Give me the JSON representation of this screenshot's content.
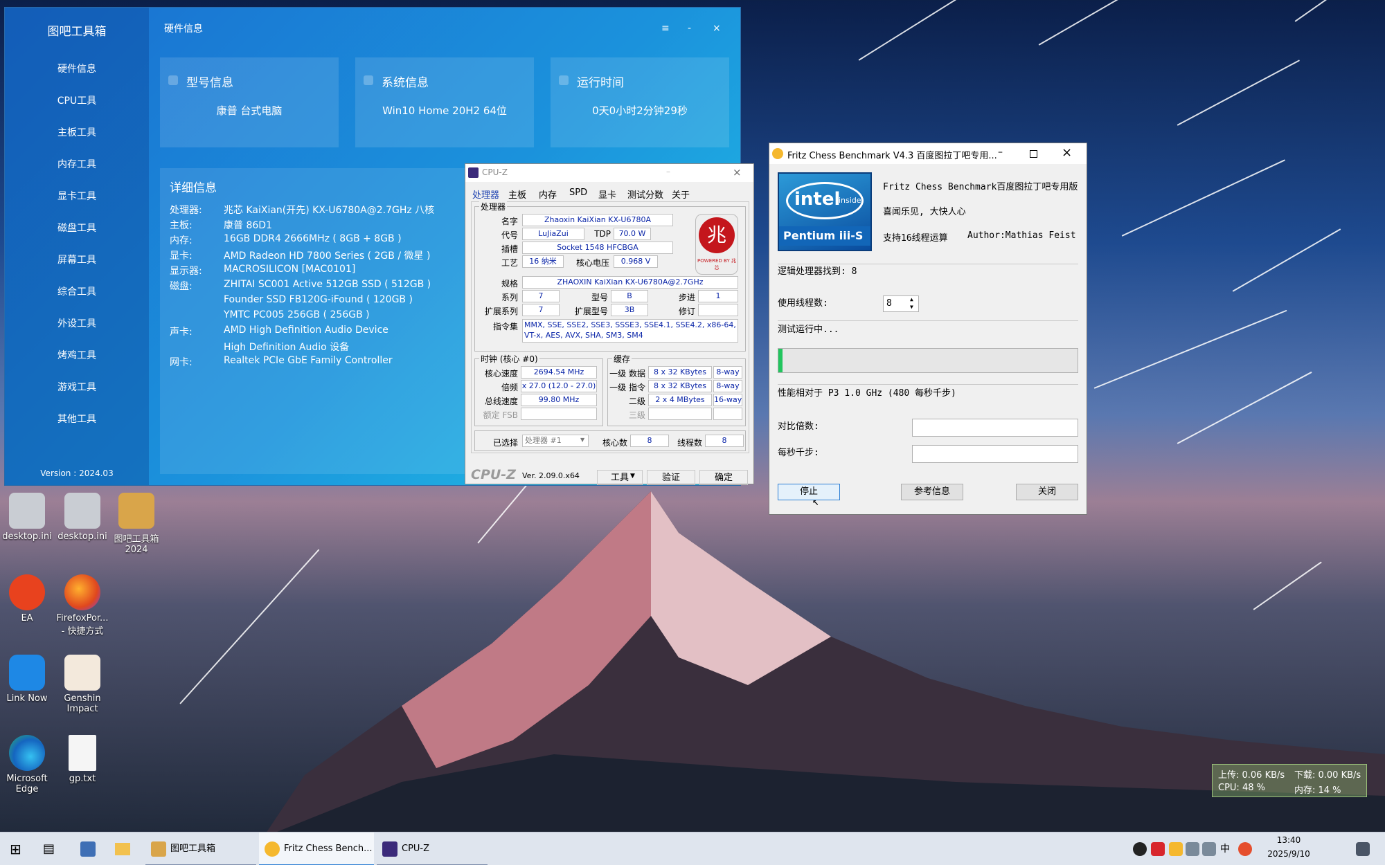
{
  "toolbox": {
    "title": "图吧工具箱",
    "nav": [
      "硬件信息",
      "CPU工具",
      "主板工具",
      "内存工具",
      "显卡工具",
      "磁盘工具",
      "屏幕工具",
      "综合工具",
      "外设工具",
      "烤鸡工具",
      "游戏工具",
      "其他工具"
    ],
    "version": "Version : 2024.03",
    "header": "硬件信息",
    "ctrl": {
      "menu": "≡",
      "min": "-",
      "close": "×"
    },
    "cards": [
      {
        "title": "型号信息",
        "value": "康普  台式电脑"
      },
      {
        "title": "系统信息",
        "value": "Win10 Home 20H2 64位"
      },
      {
        "title": "运行时间",
        "value": "0天0小时2分钟29秒"
      }
    ],
    "detail": {
      "title": "详细信息",
      "rows": [
        {
          "label": "处理器:",
          "value": "兆芯 KaiXian(开先) KX-U6780A@2.7GHz 八核"
        },
        {
          "label": "主板:",
          "value": "康普 86D1"
        },
        {
          "label": "内存:",
          "value": "16GB DDR4 2666MHz ( 8GB + 8GB )"
        },
        {
          "label": "显卡:",
          "value": "AMD Radeon HD 7800 Series ( 2GB / 微星 )"
        },
        {
          "label": "显示器:",
          "value": "MACROSILICON [MAC0101]"
        },
        {
          "label": "磁盘:",
          "value": "ZHITAI SC001 Active 512GB SSD ( 512GB )"
        },
        {
          "label": "",
          "value": "Founder SSD FB120G-iFound ( 120GB )"
        },
        {
          "label": "",
          "value": "YMTC PC005 256GB ( 256GB )"
        },
        {
          "label": "声卡:",
          "value": "AMD High Definition Audio Device"
        },
        {
          "label": "",
          "value": "High Definition Audio 设备"
        },
        {
          "label": "网卡:",
          "value": "Realtek PCIe GbE Family Controller"
        }
      ]
    }
  },
  "cpuz": {
    "title": "CPU-Z",
    "tabs": [
      "处理器",
      "主板",
      "内存",
      "SPD",
      "显卡",
      "测试分数",
      "关于"
    ],
    "processor_group": "处理器",
    "labels": {
      "name": "名字",
      "code": "代号",
      "tdp": "TDP",
      "socket": "插槽",
      "process": "工艺",
      "voltage": "核心电压",
      "spec": "规格",
      "family": "系列",
      "model": "型号",
      "stepping": "步进",
      "ext_family": "扩展系列",
      "ext_model": "扩展型号",
      "revision": "修订",
      "instructions": "指令集"
    },
    "values": {
      "name": "Zhaoxin KaiXian KX-U6780A",
      "code": "LuJiaZui",
      "tdp": "70.0 W",
      "socket": "Socket 1548 HFCBGA",
      "process": "16 纳米",
      "voltage": "0.968 V",
      "spec": "ZHAOXIN KaiXian KX-U6780A@2.7GHz",
      "family": "7",
      "model": "B",
      "stepping": "1",
      "ext_family": "7",
      "ext_model": "3B",
      "revision": "",
      "instructions": "MMX, SSE, SSE2, SSE3, SSSE3, SSE4.1, SSE4.2, x86-64, VT-x, AES, AVX, SHA, SM3, SM4"
    },
    "logo_text": "兆",
    "logo_sub": "POWERED BY 兆芯",
    "clock_group": "时钟 (核心 #0)",
    "clock_labels": {
      "core_speed": "核心速度",
      "multiplier": "倍频",
      "bus_speed": "总线速度",
      "rated_fsb": "额定 FSB"
    },
    "clock_values": {
      "core_speed": "2694.54 MHz",
      "multiplier": "x 27.0 (12.0 - 27.0)",
      "bus_speed": "99.80 MHz",
      "rated_fsb": ""
    },
    "cache_group": "缓存",
    "cache_labels": {
      "l1d": "一级 数据",
      "l1i": "一级 指令",
      "l2": "二级",
      "l3": "三级"
    },
    "cache_values": {
      "l1d": "8 x 32 KBytes",
      "l1d_way": "8-way",
      "l1i": "8 x 32 KBytes",
      "l1i_way": "8-way",
      "l2": "2 x 4 MBytes",
      "l2_way": "16-way",
      "l3": "",
      "l3_way": ""
    },
    "selected_label": "已选择",
    "selected_value": "处理器 #1",
    "cores_label": "核心数",
    "cores_value": "8",
    "threads_label": "线程数",
    "threads_value": "8",
    "brand": "CPU-Z",
    "version": "Ver. 2.09.0.x64",
    "tools_btn": "工具",
    "validate_btn": "验证",
    "ok_btn": "确定"
  },
  "fritz": {
    "title": "Fritz Chess Benchmark V4.3  百度图拉丁吧专用...",
    "logo_brand": "intel",
    "logo_inside": "inside",
    "logo_product": "Pentium iii-S",
    "heading": "Fritz Chess Benchmark百度图拉丁吧专用版",
    "slogan": "喜闻乐见, 大快人心",
    "threads_support": "支持16线程运算",
    "author": "Author:Mathias Feist",
    "logical_found": "逻辑处理器找到: 8",
    "use_threads_label": "使用线程数:",
    "use_threads_value": "8",
    "status": "测试运行中...",
    "progress": 0.01,
    "relative": "性能相对于 P3 1.0 GHz (480 每秒千步)",
    "ratio_label": "对比倍数:",
    "ratio_value": "",
    "kns_label": "每秒千步:",
    "kns_value": "",
    "stop_btn": "停止",
    "ref_btn": "参考信息",
    "close_btn": "关闭"
  },
  "desktop_icons": [
    {
      "label": "desktop.ini",
      "icon": "gear-file-icon"
    },
    {
      "label": "desktop.ini",
      "icon": "gear-file-icon"
    },
    {
      "label": "图吧工具箱 2024",
      "icon": "toolbox-icon"
    },
    {
      "label": "EA",
      "icon": "ea-icon"
    },
    {
      "label": "FirefoxPor... - 快捷方式",
      "icon": "firefox-icon"
    },
    {
      "label": "Link Now",
      "icon": "link-now-icon"
    },
    {
      "label": "Genshin Impact",
      "icon": "genshin-icon"
    },
    {
      "label": "Microsoft Edge",
      "icon": "edge-icon"
    },
    {
      "label": "gp.txt",
      "icon": "text-file-icon"
    }
  ],
  "netmon": {
    "upload": "上传: 0.06 KB/s",
    "download": "下载: 0.00 KB/s",
    "cpu": "CPU: 48 %",
    "mem": "内存: 14 %"
  },
  "taskbar": {
    "items": [
      {
        "label": "图吧工具箱"
      },
      {
        "label": "Fritz Chess Bench..."
      },
      {
        "label": "CPU-Z"
      }
    ],
    "time": "13:40",
    "date": "2025/9/10",
    "ime": "中"
  },
  "colors": {
    "toolbox_accent": "#1b92dc",
    "cpuz_value": "#0a25a8",
    "progress": "#22c55e"
  }
}
